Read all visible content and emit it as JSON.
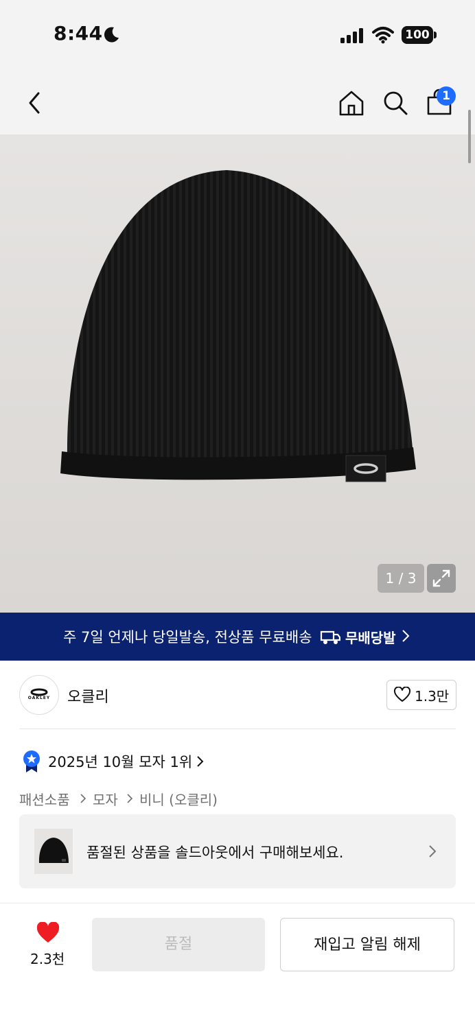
{
  "status_bar": {
    "time": "8:44",
    "battery": "100"
  },
  "header": {
    "cart_count": "1"
  },
  "gallery": {
    "counter": "1 / 3"
  },
  "banner": {
    "text": "주 7일 언제나 당일발송, 전상품 무료배송",
    "logo_text": "무배당발"
  },
  "brand": {
    "name": "오클리",
    "logo_text": "OAKLEY",
    "likes": "1.3만"
  },
  "ranking": {
    "text": "2025년 10월 모자 1위"
  },
  "breadcrumb": [
    "패션소품",
    "모자",
    "비니 (오클리)"
  ],
  "soldout_card": {
    "text": "품절된 상품을 솔드아웃에서 구매해보세요."
  },
  "bottom_bar": {
    "like_count": "2.3천",
    "soldout_label": "품절",
    "restock_label": "재입고 알림 해제"
  },
  "colors": {
    "accent_blue": "#1e6bff",
    "banner_navy": "#0b2270",
    "heart_red": "#ee1d23"
  }
}
